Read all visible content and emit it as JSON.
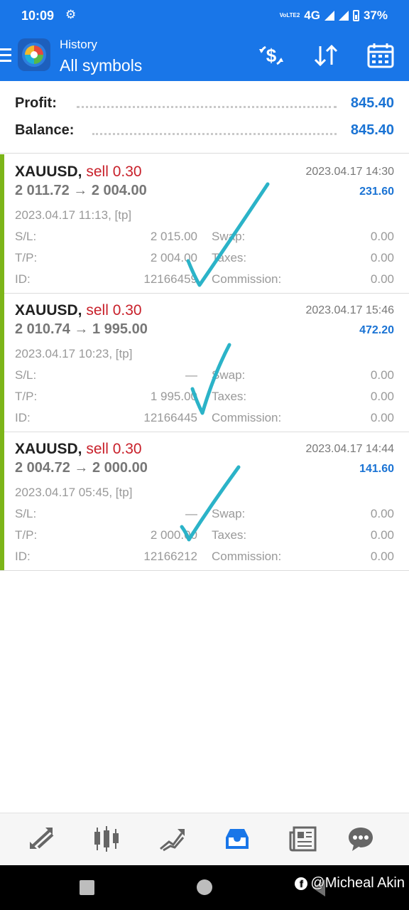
{
  "status_bar": {
    "time": "10:09",
    "network": "4G",
    "volte": "VoLTE2",
    "battery": "37%"
  },
  "header": {
    "title_small": "History",
    "title_big": "All symbols",
    "icons": [
      "menu-icon",
      "app-logo",
      "currency-exchange-icon",
      "sort-icon",
      "calendar-icon"
    ]
  },
  "summary": {
    "profit_label": "Profit:",
    "profit_value": "845.40",
    "balance_label": "Balance:",
    "balance_value": "845.40"
  },
  "labels": {
    "sl": "S/L:",
    "tp": "T/P:",
    "id": "ID:",
    "swap": "Swap:",
    "taxes": "Taxes:",
    "commission": "Commission:"
  },
  "deals": [
    {
      "symbol": "XAUUSD,",
      "side": "sell 0.30",
      "close_time": "2023.04.17 14:30",
      "prices": "2 011.72 → 2 004.00",
      "profit": "231.60",
      "open_info": "2023.04.17 11:13, [tp]",
      "sl": "2 015.00",
      "tp": "2 004.00",
      "id": "12166459",
      "swap": "0.00",
      "taxes": "0.00",
      "commission": "0.00"
    },
    {
      "symbol": "XAUUSD,",
      "side": "sell 0.30",
      "close_time": "2023.04.17 15:46",
      "prices": "2 010.74 → 1 995.00",
      "profit": "472.20",
      "open_info": "2023.04.17 10:23, [tp]",
      "sl": "—",
      "tp": "1 995.00",
      "id": "12166445",
      "swap": "0.00",
      "taxes": "0.00",
      "commission": "0.00"
    },
    {
      "symbol": "XAUUSD,",
      "side": "sell 0.30",
      "close_time": "2023.04.17 14:44",
      "prices": "2 004.72 → 2 000.00",
      "profit": "141.60",
      "open_info": "2023.04.17 05:45, [tp]",
      "sl": "—",
      "tp": "2 000.00",
      "id": "12166212",
      "swap": "0.00",
      "taxes": "0.00",
      "commission": "0.00"
    }
  ],
  "bottom_nav": [
    "quotes-icon",
    "chart-icon",
    "trade-icon",
    "history-icon",
    "news-icon",
    "chat-icon"
  ],
  "bottom_nav_active": "history-icon",
  "watermark": "@Micheal Akin",
  "colors": {
    "accent": "#1976e8",
    "profit": "#1a73d4",
    "sell": "#c8202a",
    "deal_bar": "#7cb518",
    "checkmark": "#2bb3c8"
  }
}
